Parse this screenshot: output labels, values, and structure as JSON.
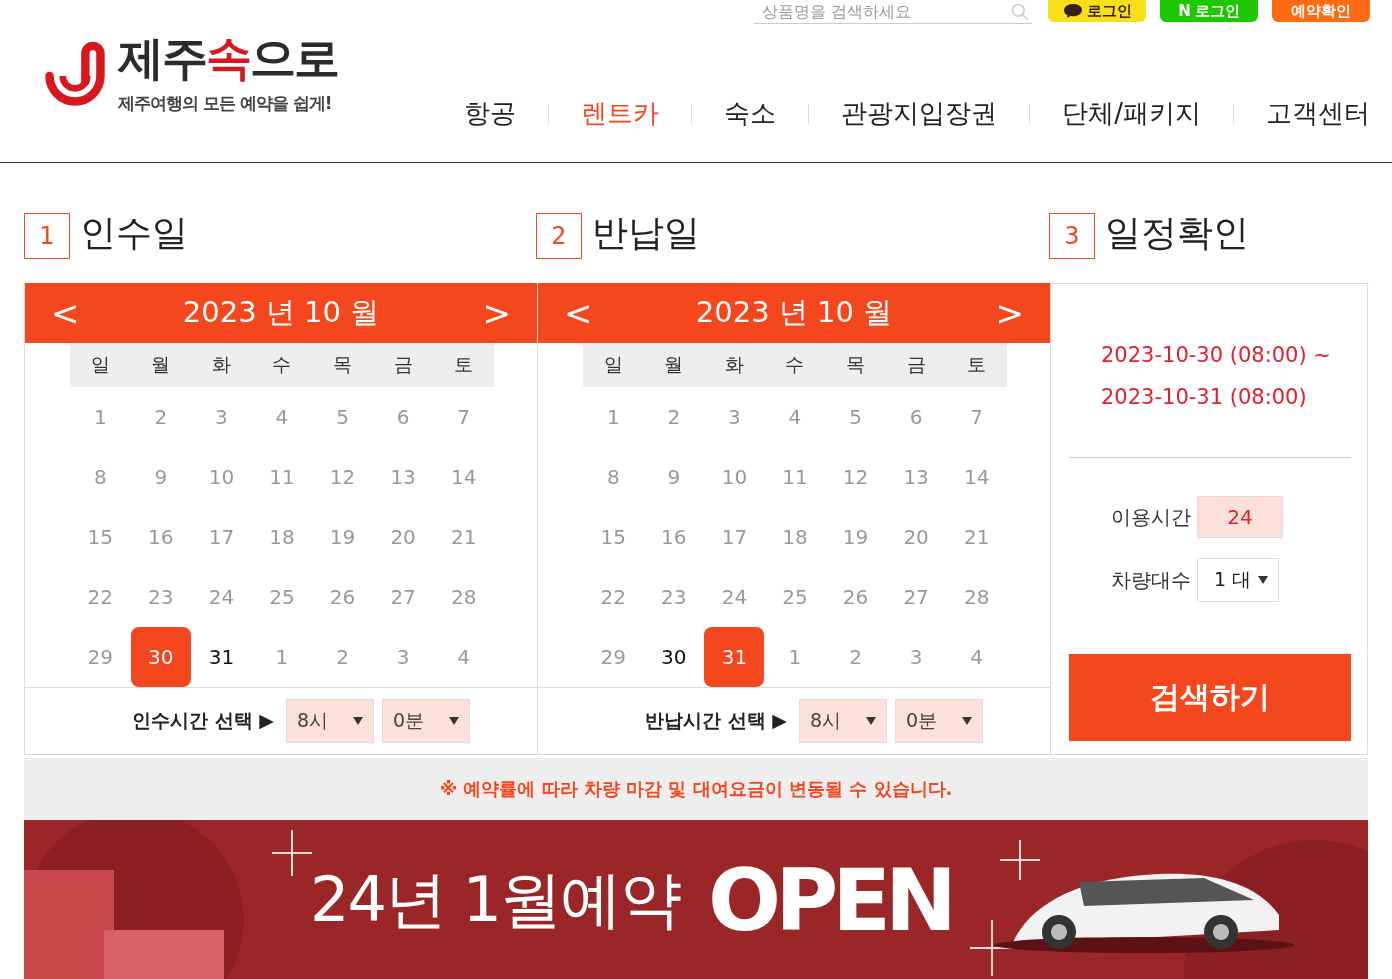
{
  "header": {
    "logo_title_parts": [
      {
        "text": "제주",
        "accent": false
      },
      {
        "text": "속",
        "accent": true
      },
      {
        "text": "으로",
        "accent": false
      }
    ],
    "logo_tagline": "제주여행의 모든 예약을 쉽게!",
    "search": {
      "placeholder": "상품명을 검색하세요"
    },
    "top_buttons": [
      {
        "kind": "kakao",
        "label": "로그인"
      },
      {
        "kind": "naver",
        "label": "로그인",
        "mark": "N"
      },
      {
        "kind": "reserve",
        "label": "예약확인"
      }
    ],
    "nav": [
      {
        "label": "항공",
        "selected": false
      },
      {
        "label": "렌트카",
        "selected": true
      },
      {
        "label": "숙소",
        "selected": false
      },
      {
        "label": "관광지입장권",
        "selected": false
      },
      {
        "label": "단체/패키지",
        "selected": false
      },
      {
        "label": "고객센터",
        "selected": false
      }
    ]
  },
  "steps": [
    {
      "number": "1",
      "title": "인수일"
    },
    {
      "number": "2",
      "title": "반납일"
    },
    {
      "number": "3",
      "title": "일정확인"
    }
  ],
  "calendars": [
    {
      "title": "2023 년 10 월",
      "prev": "<",
      "next": ">",
      "weekdays": [
        "일",
        "월",
        "화",
        "수",
        "목",
        "금",
        "토"
      ],
      "days": [
        {
          "label": "1",
          "disabled": true,
          "selected": false
        },
        {
          "label": "2",
          "disabled": true,
          "selected": false
        },
        {
          "label": "3",
          "disabled": true,
          "selected": false
        },
        {
          "label": "4",
          "disabled": true,
          "selected": false
        },
        {
          "label": "5",
          "disabled": true,
          "selected": false
        },
        {
          "label": "6",
          "disabled": true,
          "selected": false
        },
        {
          "label": "7",
          "disabled": true,
          "selected": false
        },
        {
          "label": "8",
          "disabled": true,
          "selected": false
        },
        {
          "label": "9",
          "disabled": true,
          "selected": false
        },
        {
          "label": "10",
          "disabled": true,
          "selected": false
        },
        {
          "label": "11",
          "disabled": true,
          "selected": false
        },
        {
          "label": "12",
          "disabled": true,
          "selected": false
        },
        {
          "label": "13",
          "disabled": true,
          "selected": false
        },
        {
          "label": "14",
          "disabled": true,
          "selected": false
        },
        {
          "label": "15",
          "disabled": true,
          "selected": false
        },
        {
          "label": "16",
          "disabled": true,
          "selected": false
        },
        {
          "label": "17",
          "disabled": true,
          "selected": false
        },
        {
          "label": "18",
          "disabled": true,
          "selected": false
        },
        {
          "label": "19",
          "disabled": true,
          "selected": false
        },
        {
          "label": "20",
          "disabled": true,
          "selected": false
        },
        {
          "label": "21",
          "disabled": true,
          "selected": false
        },
        {
          "label": "22",
          "disabled": true,
          "selected": false
        },
        {
          "label": "23",
          "disabled": true,
          "selected": false
        },
        {
          "label": "24",
          "disabled": true,
          "selected": false
        },
        {
          "label": "25",
          "disabled": true,
          "selected": false
        },
        {
          "label": "26",
          "disabled": true,
          "selected": false
        },
        {
          "label": "27",
          "disabled": true,
          "selected": false
        },
        {
          "label": "28",
          "disabled": true,
          "selected": false
        },
        {
          "label": "29",
          "disabled": true,
          "selected": false
        },
        {
          "label": "30",
          "disabled": false,
          "selected": true
        },
        {
          "label": "31",
          "disabled": false,
          "selected": false
        },
        {
          "label": "1",
          "disabled": true,
          "selected": false
        },
        {
          "label": "2",
          "disabled": true,
          "selected": false
        },
        {
          "label": "3",
          "disabled": true,
          "selected": false
        },
        {
          "label": "4",
          "disabled": true,
          "selected": false
        }
      ],
      "time_label": "인수시간 선택 ▶",
      "hour": "8시",
      "minute": "0분"
    },
    {
      "title": "2023 년 10 월",
      "prev": "<",
      "next": ">",
      "weekdays": [
        "일",
        "월",
        "화",
        "수",
        "목",
        "금",
        "토"
      ],
      "days": [
        {
          "label": "1",
          "disabled": true,
          "selected": false
        },
        {
          "label": "2",
          "disabled": true,
          "selected": false
        },
        {
          "label": "3",
          "disabled": true,
          "selected": false
        },
        {
          "label": "4",
          "disabled": true,
          "selected": false
        },
        {
          "label": "5",
          "disabled": true,
          "selected": false
        },
        {
          "label": "6",
          "disabled": true,
          "selected": false
        },
        {
          "label": "7",
          "disabled": true,
          "selected": false
        },
        {
          "label": "8",
          "disabled": true,
          "selected": false
        },
        {
          "label": "9",
          "disabled": true,
          "selected": false
        },
        {
          "label": "10",
          "disabled": true,
          "selected": false
        },
        {
          "label": "11",
          "disabled": true,
          "selected": false
        },
        {
          "label": "12",
          "disabled": true,
          "selected": false
        },
        {
          "label": "13",
          "disabled": true,
          "selected": false
        },
        {
          "label": "14",
          "disabled": true,
          "selected": false
        },
        {
          "label": "15",
          "disabled": true,
          "selected": false
        },
        {
          "label": "16",
          "disabled": true,
          "selected": false
        },
        {
          "label": "17",
          "disabled": true,
          "selected": false
        },
        {
          "label": "18",
          "disabled": true,
          "selected": false
        },
        {
          "label": "19",
          "disabled": true,
          "selected": false
        },
        {
          "label": "20",
          "disabled": true,
          "selected": false
        },
        {
          "label": "21",
          "disabled": true,
          "selected": false
        },
        {
          "label": "22",
          "disabled": true,
          "selected": false
        },
        {
          "label": "23",
          "disabled": true,
          "selected": false
        },
        {
          "label": "24",
          "disabled": true,
          "selected": false
        },
        {
          "label": "25",
          "disabled": true,
          "selected": false
        },
        {
          "label": "26",
          "disabled": true,
          "selected": false
        },
        {
          "label": "27",
          "disabled": true,
          "selected": false
        },
        {
          "label": "28",
          "disabled": true,
          "selected": false
        },
        {
          "label": "29",
          "disabled": true,
          "selected": false
        },
        {
          "label": "30",
          "disabled": false,
          "selected": false
        },
        {
          "label": "31",
          "disabled": false,
          "selected": true
        },
        {
          "label": "1",
          "disabled": true,
          "selected": false
        },
        {
          "label": "2",
          "disabled": true,
          "selected": false
        },
        {
          "label": "3",
          "disabled": true,
          "selected": false
        },
        {
          "label": "4",
          "disabled": true,
          "selected": false
        }
      ],
      "time_label": "반납시간 선택 ▶",
      "hour": "8시",
      "minute": "0분"
    }
  ],
  "summary": {
    "range_start": "2023-10-30 (08:00) ~",
    "range_end": "2023-10-31 (08:00)",
    "hours_label": "이용시간",
    "hours": "24",
    "cars_label": "차량대수",
    "cars": "1 대",
    "search_button": "검색하기"
  },
  "notice": "※ 예약률에 따라 차량 마감 및 대여요금이 변동될 수 있습니다.",
  "banner": {
    "headline": "**24년 1월**예약",
    "badge": "OPEN"
  }
}
